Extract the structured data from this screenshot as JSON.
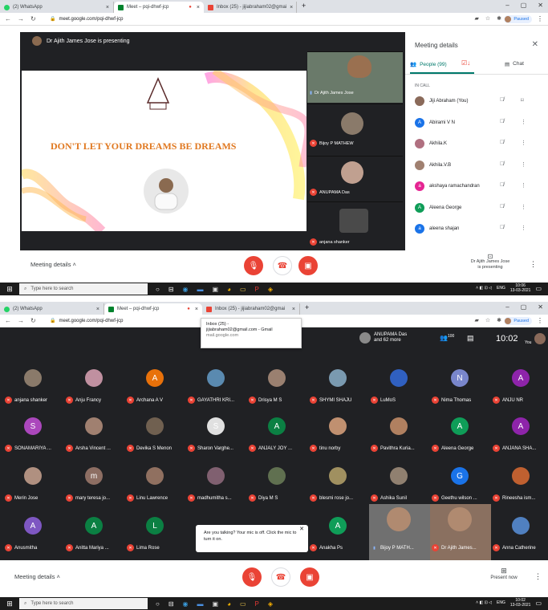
{
  "top": {
    "tabs": [
      {
        "label": "(2) WhatsApp",
        "color": "#25d366"
      },
      {
        "label": "Meet – pqi-dhwf-jcp",
        "color": "#00832d"
      },
      {
        "label": "Inbox (25) - jijiabraham02@gmai",
        "color": "#ea4335"
      }
    ],
    "url": "meet.google.com/pqi-dhwf-jcp",
    "paused_label": "Paused",
    "presenting_banner": "Dr Ajith James Jose is presenting",
    "slide_text": "DON'T LET YOUR DREAMS BE DREAMS",
    "side_tiles": [
      {
        "name": "Dr Ajith James Jose"
      },
      {
        "name": "Bijoy P MATHEW"
      },
      {
        "name": "ANUPAMA Das"
      },
      {
        "name": "anjana shanker"
      }
    ],
    "panel": {
      "title": "Meeting details",
      "people_tab": "People (99)",
      "chat_tab": "Chat",
      "section": "IN CALL",
      "people": [
        {
          "name": "Jiji Abraham (You)",
          "initial": "",
          "color": "#8a6a5a"
        },
        {
          "name": "Abirami V N",
          "initial": "A",
          "color": "#1a73e8"
        },
        {
          "name": "Akhila.K",
          "initial": "",
          "color": "#b07080"
        },
        {
          "name": "Akhila.V.B",
          "initial": "",
          "color": "#a08070"
        },
        {
          "name": "akshaya ramachandran",
          "initial": "a",
          "color": "#e52592"
        },
        {
          "name": "Aleena George",
          "initial": "A",
          "color": "#0f9d58"
        },
        {
          "name": "aleena shajan",
          "initial": "a",
          "color": "#1a73e8"
        }
      ]
    },
    "meeting_details": "Meeting details",
    "presenter_note": [
      "Dr Ajith James Jose",
      "is presenting"
    ],
    "taskbar": {
      "search_placeholder": "Type here to search",
      "lang": "ENG",
      "time": "10:06",
      "date": "13-03-2021"
    }
  },
  "bottom": {
    "tabs": [
      {
        "label": "(2) WhatsApp",
        "color": "#25d366"
      },
      {
        "label": "Meet – pqi-dhwf-jcp",
        "color": "#00832d"
      },
      {
        "label": "Inbox (25) - jijiabraham02@gmai",
        "color": "#ea4335"
      }
    ],
    "url": "meet.google.com/pqi-dhwf-jcp",
    "paused_label": "Paused",
    "tooltip": {
      "line1": "Inbox (25) -",
      "line2": "jijiabraham02@gmail.com - Gmail",
      "line3": "mail.google.com"
    },
    "header": {
      "speaker": "ANUPAMA Das",
      "more": "and 62 more",
      "people_count": "100",
      "clock": "10:02",
      "you": "You"
    },
    "grid": [
      [
        {
          "name": "anjana shanker",
          "initial": "",
          "color": "#8a7a6a"
        },
        {
          "name": "Anju Francy",
          "initial": "",
          "color": "#c090a0"
        },
        {
          "name": "Archana A V",
          "initial": "A",
          "color": "#e8710a"
        },
        {
          "name": "GAYATHRI KRI...",
          "initial": "",
          "color": "#5a8ab0"
        },
        {
          "name": "Drisya M S",
          "initial": "",
          "color": "#9a8070"
        },
        {
          "name": "SHYMI SHAJU",
          "initial": "",
          "color": "#7a9ab0"
        },
        {
          "name": "LuMoS",
          "initial": "",
          "color": "#3060c0"
        },
        {
          "name": "Nima Thomas",
          "initial": "N",
          "color": "#7986cb"
        },
        {
          "name": "ANJU NR",
          "initial": "A",
          "color": "#8e24aa"
        }
      ],
      [
        {
          "name": "SONAMARIYA ...",
          "initial": "S",
          "color": "#ab47bc"
        },
        {
          "name": "Arsha Vincent ...",
          "initial": "",
          "color": "#a08070"
        },
        {
          "name": "Devika S Menon",
          "initial": "",
          "color": "#706050"
        },
        {
          "name": "Sharon Varghe...",
          "initial": "S",
          "color": "#e0e0e0"
        },
        {
          "name": "ANJALY JOY ...",
          "initial": "A",
          "color": "#0b8043"
        },
        {
          "name": "tinu norby",
          "initial": "",
          "color": "#c09070"
        },
        {
          "name": "Pavithra Kuria...",
          "initial": "",
          "color": "#b08060"
        },
        {
          "name": "Aleena George",
          "initial": "A",
          "color": "#0f9d58"
        },
        {
          "name": "ANJANA SHA...",
          "initial": "A",
          "color": "#8e24aa"
        }
      ],
      [
        {
          "name": "Merin Jose",
          "initial": "",
          "color": "#b09080"
        },
        {
          "name": "mary teresa jo...",
          "initial": "m",
          "color": "#8d6e63"
        },
        {
          "name": "Linu Lawrence",
          "initial": "",
          "color": "#907060"
        },
        {
          "name": "madhumitha s...",
          "initial": "",
          "color": "#806070"
        },
        {
          "name": "Diya M S",
          "initial": "",
          "color": "#607050"
        },
        {
          "name": "blesmi rose jo...",
          "initial": "",
          "color": "#a09060"
        },
        {
          "name": "Ashika Sunil",
          "initial": "",
          "color": "#908070"
        },
        {
          "name": "Geethu wilson ...",
          "initial": "G",
          "color": "#1a73e8"
        },
        {
          "name": "Rineesha ism...",
          "initial": "",
          "color": "#c06030"
        }
      ],
      [
        {
          "name": "Anusmitha",
          "initial": "A",
          "color": "#7e57c2"
        },
        {
          "name": "Anitta Mariya ...",
          "initial": "A",
          "color": "#0b8043"
        },
        {
          "name": "Lima Rose",
          "initial": "L",
          "color": "#0b8043"
        },
        {
          "name": "",
          "initial": "",
          "color": ""
        },
        {
          "name": "",
          "initial": "",
          "color": ""
        },
        {
          "name": "Anakha Ps",
          "initial": "A",
          "color": "#0f9d58"
        },
        {
          "name": "Bijoy P MATH...",
          "initial": "",
          "color": "#8a7a6a"
        },
        {
          "name": "Dr Ajith James...",
          "initial": "",
          "color": "#8a7a6a"
        },
        {
          "name": "Anna Catherine",
          "initial": "",
          "color": "#5080c0"
        }
      ]
    ],
    "mic_toast": "Are you talking? Your mic is off. Click the mic to turn it on.",
    "meeting_details": "Meeting details",
    "present_now": "Present now",
    "taskbar": {
      "search_placeholder": "Type here to search",
      "lang": "ENG",
      "time": "10:02",
      "date": "13-03-2021"
    }
  }
}
